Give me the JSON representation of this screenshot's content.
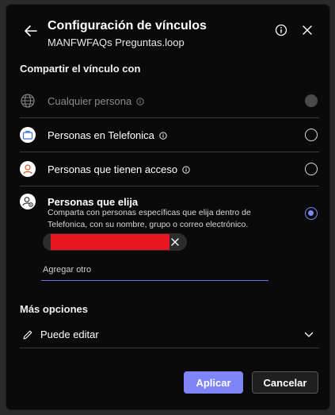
{
  "dialog": {
    "title": "Configuración de vínculos",
    "subtitle": "MANFWFAQs Preguntas.loop"
  },
  "share_section": {
    "heading": "Compartir el vínculo con",
    "options": [
      {
        "label": "Cualquier persona",
        "icon": "globe-icon",
        "state": "disabled"
      },
      {
        "label": "Personas en Telefonica",
        "icon": "briefcase-icon",
        "state": "unselected"
      },
      {
        "label": "Personas que tienen acceso",
        "icon": "person-icon",
        "state": "unselected"
      },
      {
        "label": "Personas que elija",
        "icon": "person-gear-icon",
        "state": "selected",
        "description": "Comparta con personas específicas que elija dentro de Telefonica, con su nombre, grupo o correo electrónico."
      }
    ],
    "add_placeholder": "Agregar otro"
  },
  "more_options": {
    "heading": "Más opciones",
    "permission": "Puede editar"
  },
  "buttons": {
    "apply": "Aplicar",
    "cancel": "Cancelar"
  },
  "colors": {
    "accent": "#7f85f5",
    "redaction": "#e8171f"
  }
}
